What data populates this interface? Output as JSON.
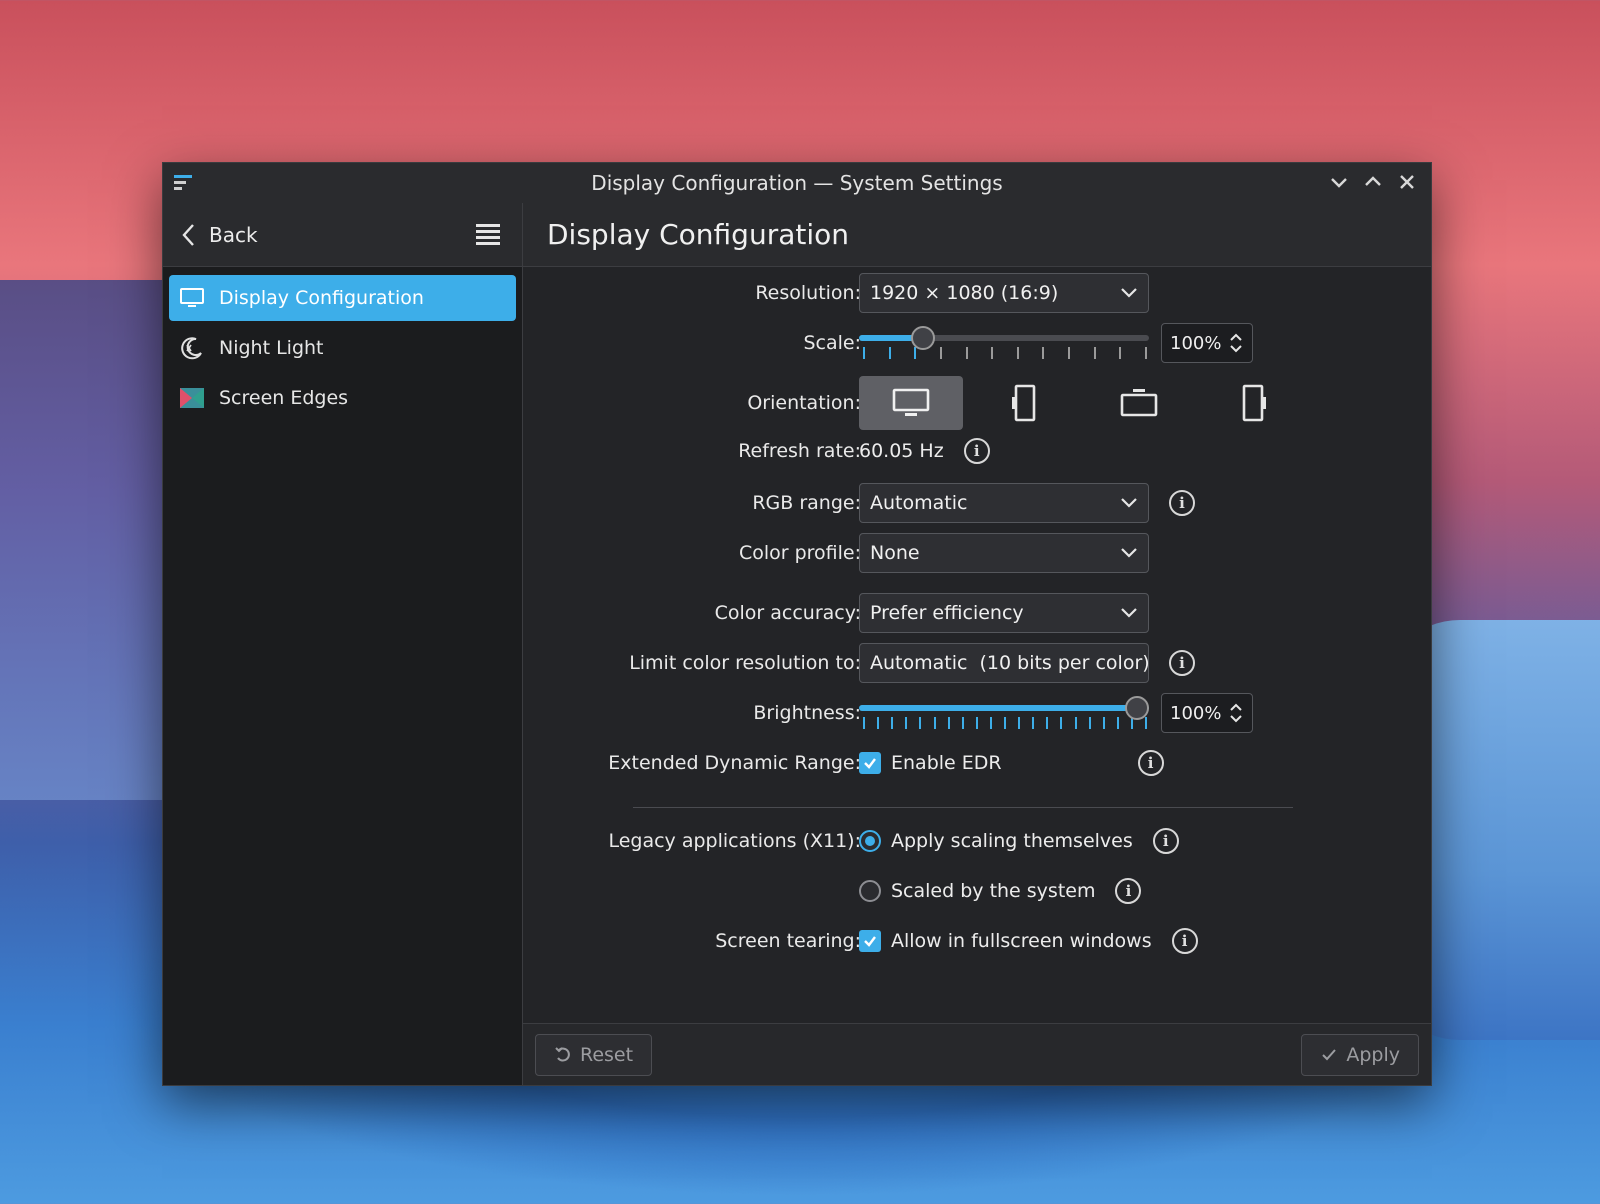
{
  "window": {
    "title": "Display Configuration — System Settings"
  },
  "header": {
    "back_label": "Back",
    "page_title": "Display Configuration"
  },
  "sidebar": {
    "items": [
      {
        "label": "Display Configuration",
        "icon": "monitor-icon",
        "active": true
      },
      {
        "label": "Night Light",
        "icon": "night-light-icon",
        "active": false
      },
      {
        "label": "Screen Edges",
        "icon": "screen-edges-icon",
        "active": false
      }
    ]
  },
  "settings": {
    "resolution": {
      "label": "Resolution:",
      "value": "1920 × 1080 (16:9)"
    },
    "scale": {
      "label": "Scale:",
      "value": "100%",
      "fraction": 0.22
    },
    "orientation": {
      "label": "Orientation:",
      "options": [
        "landscape-icon",
        "portrait-icon",
        "landscape-flipped-icon",
        "portrait-flipped-icon"
      ],
      "selected": 0
    },
    "refresh_rate": {
      "label": "Refresh rate:",
      "value": "60.05 Hz"
    },
    "rgb_range": {
      "label": "RGB range:",
      "value": "Automatic"
    },
    "color_profile": {
      "label": "Color profile:",
      "value": "None"
    },
    "color_accuracy": {
      "label": "Color accuracy:",
      "value": "Prefer efficiency"
    },
    "color_resolution": {
      "label": "Limit color resolution to:",
      "value": "Automatic  (10 bits per color)"
    },
    "brightness": {
      "label": "Brightness:",
      "value": "100%",
      "fraction": 1.0
    },
    "edr": {
      "label": "Extended Dynamic Range:",
      "option": "Enable EDR",
      "checked": true
    },
    "legacy_apps": {
      "label": "Legacy applications (X11):",
      "options": [
        "Apply scaling themselves",
        "Scaled by the system"
      ],
      "selected": 0
    },
    "screen_tearing": {
      "label": "Screen tearing:",
      "option": "Allow in fullscreen windows",
      "checked": true
    }
  },
  "footer": {
    "reset_label": "Reset",
    "apply_label": "Apply"
  },
  "colors": {
    "accent": "#3daee9",
    "window_bg": "#202124"
  }
}
